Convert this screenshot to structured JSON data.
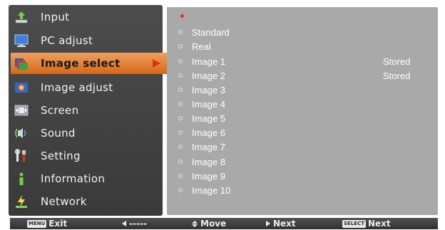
{
  "menu": {
    "items": [
      {
        "label": "Input",
        "icon": "input-arrow-icon"
      },
      {
        "label": "PC adjust",
        "icon": "monitor-icon"
      },
      {
        "label": "Image select",
        "icon": "image-select-icon",
        "selected": true
      },
      {
        "label": "Image adjust",
        "icon": "image-adjust-icon"
      },
      {
        "label": "Screen",
        "icon": "screen-icon"
      },
      {
        "label": "Sound",
        "icon": "speaker-icon"
      },
      {
        "label": "Setting",
        "icon": "tools-icon"
      },
      {
        "label": "Information",
        "icon": "info-icon"
      },
      {
        "label": "Network",
        "icon": "network-icon"
      }
    ]
  },
  "submenu": {
    "items": [
      {
        "name": "Standard",
        "status": ""
      },
      {
        "name": "Real",
        "status": ""
      },
      {
        "name": "Image 1",
        "status": "Stored"
      },
      {
        "name": "Image 2",
        "status": "Stored"
      },
      {
        "name": "Image 3",
        "status": ""
      },
      {
        "name": "Image 4",
        "status": ""
      },
      {
        "name": "Image 5",
        "status": ""
      },
      {
        "name": "Image 6",
        "status": ""
      },
      {
        "name": "Image 7",
        "status": ""
      },
      {
        "name": "Image 8",
        "status": ""
      },
      {
        "name": "Image 9",
        "status": ""
      },
      {
        "name": "Image 10",
        "status": ""
      }
    ]
  },
  "bottom_bar": {
    "exit_key": "MENU",
    "exit_label": "Exit",
    "back_label": "-----",
    "move_label": "Move",
    "next_label": "Next",
    "select_key": "SELECT",
    "select_next_label": "Next"
  },
  "colors": {
    "highlight": "#e07a2a",
    "panel": "#444444",
    "subpanel": "#a9a9a9",
    "active_dot": "#ff2a1a"
  }
}
